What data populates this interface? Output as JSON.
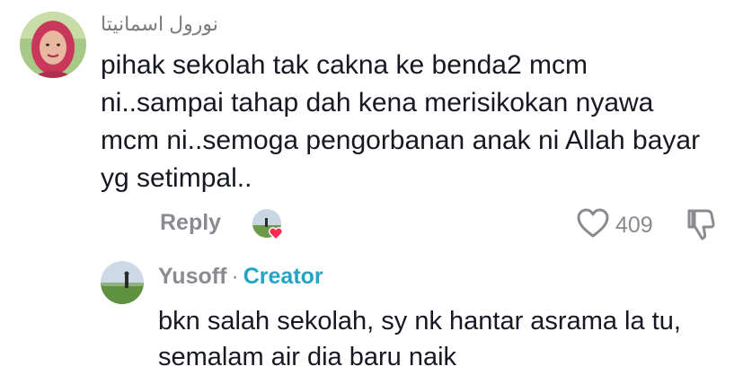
{
  "comment": {
    "avatar_icon": "user-avatar-hijab",
    "username": "نورول اسمانيتا",
    "text": "pihak sekolah tak cakna ke benda2 mcm ni..sampai tahap dah kena merisikokan nyawa mcm ni..semoga pengorbanan anak ni Allah bayar yg setimpal..",
    "reply_label": "Reply",
    "liked_by_creator_icon": "creator-liked-heart-avatar",
    "like_icon": "heart-outline-icon",
    "like_count": "409",
    "dislike_icon": "thumbs-down-icon"
  },
  "reply": {
    "avatar_icon": "user-avatar-field",
    "username": "Yusoff",
    "separator": "·",
    "creator_badge": "Creator",
    "text": "bkn salah sekolah, sy nk hantar asrama la tu, semalam air dia baru naik"
  },
  "colors": {
    "text": "#161823",
    "muted": "#8a8b91",
    "creator": "#24a4c4",
    "heart_badge": "#fe2c55"
  }
}
